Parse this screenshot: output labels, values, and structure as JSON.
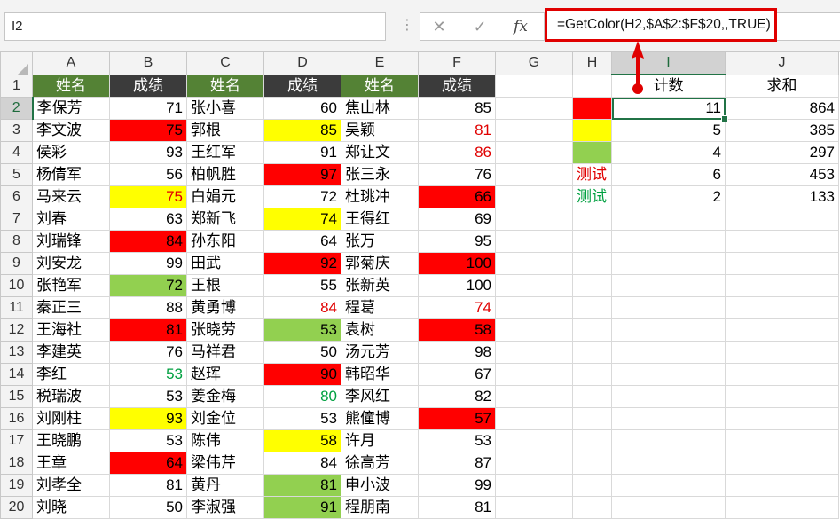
{
  "name_box": {
    "value": "I2"
  },
  "formula_bar": {
    "cancel_icon": "✕",
    "enter_icon": "✓",
    "function_icon": "fx",
    "formula": "=GetColor(H2,$A$2:$F$20,,TRUE)"
  },
  "colors": {
    "header_green": "#548235",
    "header_dark": "#3b3b3b",
    "fill_red": "#ff0000",
    "fill_yellow": "#ffff00",
    "fill_green": "#92d050",
    "font_red": "#e00000",
    "font_green": "#00a040",
    "annotation_red": "#e00000",
    "selection_green": "#217346"
  },
  "column_headers": [
    "A",
    "B",
    "C",
    "D",
    "E",
    "F",
    "G",
    "H",
    "I",
    "J"
  ],
  "selected_column": "I",
  "selected_row": "2",
  "rows": [
    {
      "n": "1",
      "cells": [
        {
          "v": "姓名",
          "s": "hdr-green"
        },
        {
          "v": "成绩",
          "s": "hdr-dark"
        },
        {
          "v": "姓名",
          "s": "hdr-green"
        },
        {
          "v": "成绩",
          "s": "hdr-dark"
        },
        {
          "v": "姓名",
          "s": "hdr-green"
        },
        {
          "v": "成绩",
          "s": "hdr-dark"
        },
        {
          "v": "",
          "s": ""
        },
        {
          "v": "",
          "s": ""
        },
        {
          "v": "计数",
          "s": "ctr"
        },
        {
          "v": "求和",
          "s": "ctr"
        }
      ]
    },
    {
      "n": "2",
      "cells": [
        {
          "v": "李保芳",
          "s": "txt"
        },
        {
          "v": "71",
          "s": "num"
        },
        {
          "v": "张小喜",
          "s": "txt"
        },
        {
          "v": "60",
          "s": "num"
        },
        {
          "v": "焦山林",
          "s": "txt"
        },
        {
          "v": "85",
          "s": "num"
        },
        {
          "v": "",
          "s": ""
        },
        {
          "v": "",
          "s": "fill-red"
        },
        {
          "v": "11",
          "s": "num active"
        },
        {
          "v": "864",
          "s": "num"
        }
      ]
    },
    {
      "n": "3",
      "cells": [
        {
          "v": "李文波",
          "s": "txt"
        },
        {
          "v": "75",
          "s": "num fill-red"
        },
        {
          "v": "郭根",
          "s": "txt"
        },
        {
          "v": "85",
          "s": "num fill-yellow"
        },
        {
          "v": "吴颖",
          "s": "txt"
        },
        {
          "v": "81",
          "s": "num font-red"
        },
        {
          "v": "",
          "s": ""
        },
        {
          "v": "",
          "s": "fill-yellow"
        },
        {
          "v": "5",
          "s": "num"
        },
        {
          "v": "385",
          "s": "num"
        }
      ]
    },
    {
      "n": "4",
      "cells": [
        {
          "v": "侯彩",
          "s": "txt"
        },
        {
          "v": "93",
          "s": "num"
        },
        {
          "v": "王红军",
          "s": "txt"
        },
        {
          "v": "91",
          "s": "num"
        },
        {
          "v": "郑让文",
          "s": "txt"
        },
        {
          "v": "86",
          "s": "num font-red"
        },
        {
          "v": "",
          "s": ""
        },
        {
          "v": "",
          "s": "fill-green"
        },
        {
          "v": "4",
          "s": "num"
        },
        {
          "v": "297",
          "s": "num"
        }
      ]
    },
    {
      "n": "5",
      "cells": [
        {
          "v": "杨倩军",
          "s": "txt"
        },
        {
          "v": "56",
          "s": "num"
        },
        {
          "v": "柏帆胜",
          "s": "txt"
        },
        {
          "v": "97",
          "s": "num fill-red"
        },
        {
          "v": "张三永",
          "s": "txt"
        },
        {
          "v": "76",
          "s": "num"
        },
        {
          "v": "",
          "s": ""
        },
        {
          "v": "测试",
          "s": "txt font-red"
        },
        {
          "v": "6",
          "s": "num"
        },
        {
          "v": "453",
          "s": "num"
        }
      ]
    },
    {
      "n": "6",
      "cells": [
        {
          "v": "马来云",
          "s": "txt"
        },
        {
          "v": "75",
          "s": "num fill-yellow font-red"
        },
        {
          "v": "白娟元",
          "s": "txt"
        },
        {
          "v": "72",
          "s": "num"
        },
        {
          "v": "杜珧冲",
          "s": "txt"
        },
        {
          "v": "66",
          "s": "num fill-red"
        },
        {
          "v": "",
          "s": ""
        },
        {
          "v": "测试",
          "s": "txt font-green"
        },
        {
          "v": "2",
          "s": "num"
        },
        {
          "v": "133",
          "s": "num"
        }
      ]
    },
    {
      "n": "7",
      "cells": [
        {
          "v": "刘春",
          "s": "txt"
        },
        {
          "v": "63",
          "s": "num"
        },
        {
          "v": "郑新飞",
          "s": "txt"
        },
        {
          "v": "74",
          "s": "num fill-yellow"
        },
        {
          "v": "王得红",
          "s": "txt"
        },
        {
          "v": "69",
          "s": "num"
        },
        {
          "v": "",
          "s": ""
        },
        {
          "v": "",
          "s": ""
        },
        {
          "v": "",
          "s": ""
        },
        {
          "v": "",
          "s": ""
        }
      ]
    },
    {
      "n": "8",
      "cells": [
        {
          "v": "刘瑞锋",
          "s": "txt"
        },
        {
          "v": "84",
          "s": "num fill-red"
        },
        {
          "v": "孙东阳",
          "s": "txt"
        },
        {
          "v": "64",
          "s": "num"
        },
        {
          "v": "张万",
          "s": "txt"
        },
        {
          "v": "95",
          "s": "num"
        },
        {
          "v": "",
          "s": ""
        },
        {
          "v": "",
          "s": ""
        },
        {
          "v": "",
          "s": ""
        },
        {
          "v": "",
          "s": ""
        }
      ]
    },
    {
      "n": "9",
      "cells": [
        {
          "v": "刘安龙",
          "s": "txt"
        },
        {
          "v": "99",
          "s": "num"
        },
        {
          "v": "田武",
          "s": "txt"
        },
        {
          "v": "92",
          "s": "num fill-red"
        },
        {
          "v": "郭菊庆",
          "s": "txt"
        },
        {
          "v": "100",
          "s": "num fill-red"
        },
        {
          "v": "",
          "s": ""
        },
        {
          "v": "",
          "s": ""
        },
        {
          "v": "",
          "s": ""
        },
        {
          "v": "",
          "s": ""
        }
      ]
    },
    {
      "n": "10",
      "cells": [
        {
          "v": "张艳军",
          "s": "txt"
        },
        {
          "v": "72",
          "s": "num fill-green"
        },
        {
          "v": "王根",
          "s": "txt"
        },
        {
          "v": "55",
          "s": "num"
        },
        {
          "v": "张新英",
          "s": "txt"
        },
        {
          "v": "100",
          "s": "num"
        },
        {
          "v": "",
          "s": ""
        },
        {
          "v": "",
          "s": ""
        },
        {
          "v": "",
          "s": ""
        },
        {
          "v": "",
          "s": ""
        }
      ]
    },
    {
      "n": "11",
      "cells": [
        {
          "v": "秦正三",
          "s": "txt"
        },
        {
          "v": "88",
          "s": "num"
        },
        {
          "v": "黄勇博",
          "s": "txt"
        },
        {
          "v": "84",
          "s": "num font-red"
        },
        {
          "v": "程葛",
          "s": "txt"
        },
        {
          "v": "74",
          "s": "num font-red"
        },
        {
          "v": "",
          "s": ""
        },
        {
          "v": "",
          "s": ""
        },
        {
          "v": "",
          "s": ""
        },
        {
          "v": "",
          "s": ""
        }
      ]
    },
    {
      "n": "12",
      "cells": [
        {
          "v": "王海社",
          "s": "txt"
        },
        {
          "v": "81",
          "s": "num fill-red"
        },
        {
          "v": "张晓劳",
          "s": "txt"
        },
        {
          "v": "53",
          "s": "num fill-green"
        },
        {
          "v": "袁树",
          "s": "txt"
        },
        {
          "v": "58",
          "s": "num fill-red"
        },
        {
          "v": "",
          "s": ""
        },
        {
          "v": "",
          "s": ""
        },
        {
          "v": "",
          "s": ""
        },
        {
          "v": "",
          "s": ""
        }
      ]
    },
    {
      "n": "13",
      "cells": [
        {
          "v": "李建英",
          "s": "txt"
        },
        {
          "v": "76",
          "s": "num"
        },
        {
          "v": "马祥君",
          "s": "txt"
        },
        {
          "v": "50",
          "s": "num"
        },
        {
          "v": "汤元芳",
          "s": "txt"
        },
        {
          "v": "98",
          "s": "num"
        },
        {
          "v": "",
          "s": ""
        },
        {
          "v": "",
          "s": ""
        },
        {
          "v": "",
          "s": ""
        },
        {
          "v": "",
          "s": ""
        }
      ]
    },
    {
      "n": "14",
      "cells": [
        {
          "v": "李红",
          "s": "txt"
        },
        {
          "v": "53",
          "s": "num font-green"
        },
        {
          "v": "赵珲",
          "s": "txt"
        },
        {
          "v": "90",
          "s": "num fill-red"
        },
        {
          "v": "韩昭华",
          "s": "txt"
        },
        {
          "v": "67",
          "s": "num"
        },
        {
          "v": "",
          "s": ""
        },
        {
          "v": "",
          "s": ""
        },
        {
          "v": "",
          "s": ""
        },
        {
          "v": "",
          "s": ""
        }
      ]
    },
    {
      "n": "15",
      "cells": [
        {
          "v": "税瑞波",
          "s": "txt"
        },
        {
          "v": "53",
          "s": "num"
        },
        {
          "v": "姜金梅",
          "s": "txt"
        },
        {
          "v": "80",
          "s": "num font-green"
        },
        {
          "v": "李风红",
          "s": "txt"
        },
        {
          "v": "82",
          "s": "num"
        },
        {
          "v": "",
          "s": ""
        },
        {
          "v": "",
          "s": ""
        },
        {
          "v": "",
          "s": ""
        },
        {
          "v": "",
          "s": ""
        }
      ]
    },
    {
      "n": "16",
      "cells": [
        {
          "v": "刘刚柱",
          "s": "txt"
        },
        {
          "v": "93",
          "s": "num fill-yellow"
        },
        {
          "v": "刘金位",
          "s": "txt"
        },
        {
          "v": "53",
          "s": "num"
        },
        {
          "v": "熊僮博",
          "s": "txt"
        },
        {
          "v": "57",
          "s": "num fill-red"
        },
        {
          "v": "",
          "s": ""
        },
        {
          "v": "",
          "s": ""
        },
        {
          "v": "",
          "s": ""
        },
        {
          "v": "",
          "s": ""
        }
      ]
    },
    {
      "n": "17",
      "cells": [
        {
          "v": "王晓鹏",
          "s": "txt"
        },
        {
          "v": "53",
          "s": "num"
        },
        {
          "v": "陈伟",
          "s": "txt"
        },
        {
          "v": "58",
          "s": "num fill-yellow"
        },
        {
          "v": "许月",
          "s": "txt"
        },
        {
          "v": "53",
          "s": "num"
        },
        {
          "v": "",
          "s": ""
        },
        {
          "v": "",
          "s": ""
        },
        {
          "v": "",
          "s": ""
        },
        {
          "v": "",
          "s": ""
        }
      ]
    },
    {
      "n": "18",
      "cells": [
        {
          "v": "王章",
          "s": "txt"
        },
        {
          "v": "64",
          "s": "num fill-red"
        },
        {
          "v": "梁伟芹",
          "s": "txt"
        },
        {
          "v": "84",
          "s": "num"
        },
        {
          "v": "徐高芳",
          "s": "txt"
        },
        {
          "v": "87",
          "s": "num"
        },
        {
          "v": "",
          "s": ""
        },
        {
          "v": "",
          "s": ""
        },
        {
          "v": "",
          "s": ""
        },
        {
          "v": "",
          "s": ""
        }
      ]
    },
    {
      "n": "19",
      "cells": [
        {
          "v": "刘孝全",
          "s": "txt"
        },
        {
          "v": "81",
          "s": "num"
        },
        {
          "v": "黄丹",
          "s": "txt"
        },
        {
          "v": "81",
          "s": "num fill-green"
        },
        {
          "v": "申小波",
          "s": "txt"
        },
        {
          "v": "99",
          "s": "num"
        },
        {
          "v": "",
          "s": ""
        },
        {
          "v": "",
          "s": ""
        },
        {
          "v": "",
          "s": ""
        },
        {
          "v": "",
          "s": ""
        }
      ]
    },
    {
      "n": "20",
      "cells": [
        {
          "v": "刘晓",
          "s": "txt"
        },
        {
          "v": "50",
          "s": "num"
        },
        {
          "v": "李淑强",
          "s": "txt"
        },
        {
          "v": "91",
          "s": "num fill-green"
        },
        {
          "v": "程朋南",
          "s": "txt"
        },
        {
          "v": "81",
          "s": "num"
        },
        {
          "v": "",
          "s": ""
        },
        {
          "v": "",
          "s": ""
        },
        {
          "v": "",
          "s": ""
        },
        {
          "v": "",
          "s": ""
        }
      ]
    }
  ]
}
